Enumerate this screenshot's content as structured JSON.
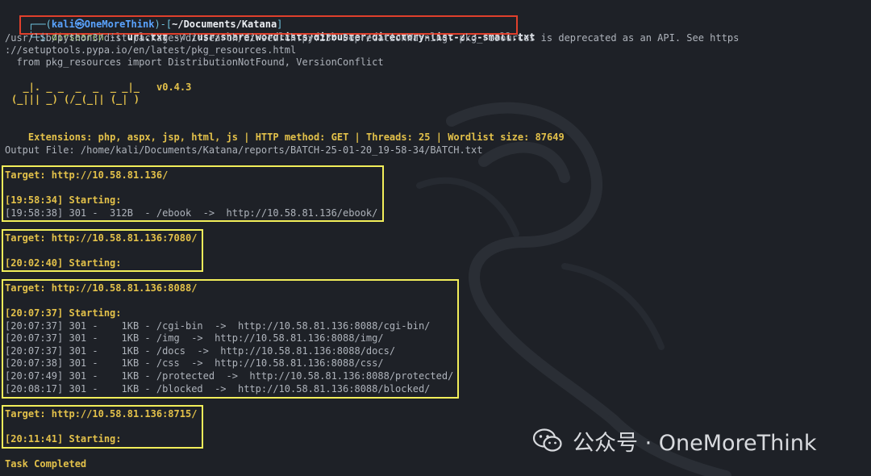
{
  "prompt": {
    "user": "kali",
    "at": "㉿",
    "host": "OneMoreThink",
    "path": "~/Documents/Katana",
    "top_left": "┌──(",
    "top_mid": ")-[",
    "top_right": "]",
    "bottom": "└─$"
  },
  "command": {
    "bin": "dirsearch",
    "flag1": "-l",
    "arg1": "url.txt",
    "flag2": "-w",
    "arg2": "/usr/share/wordlists/dirbuster/directory-list-2.3-small.txt"
  },
  "warning_lines": [
    "/usr/lib/python3/dist-packages/dirsearch/dirsearch.py:23: DeprecationWarning: pkg_resources is deprecated as an API. See https",
    "://setuptools.pypa.io/en/latest/pkg_resources.html",
    "  from pkg_resources import DistributionNotFound, VersionConflict"
  ],
  "banner": {
    "logo_line1": "  _|. _ _  _  _  _ _|_",
    "logo_line2": "(_||| _) (/_(_|| (_| )",
    "version": "v0.4.3"
  },
  "config": {
    "ext_label": "Extensions:",
    "ext_value": "php, aspx, jsp, html, js",
    "method_label": "HTTP method:",
    "method_value": "GET",
    "threads_label": "Threads:",
    "threads_value": "25",
    "wordlist_label": "Wordlist size:",
    "wordlist_value": "87649",
    "separator": " | "
  },
  "output_file": "Output File: /home/kali/Documents/Katana/reports/BATCH-25-01-20_19-58-34/BATCH.txt",
  "targets": [
    {
      "target": "Target: http://10.58.81.136/",
      "starting": "[19:58:34] Starting:",
      "results": [
        "[19:58:38] 301 -  312B  - /ebook  ->  http://10.58.81.136/ebook/"
      ]
    },
    {
      "target": "Target: http://10.58.81.136:7080/",
      "starting": "[20:02:40] Starting:",
      "results": []
    },
    {
      "target": "Target: http://10.58.81.136:8088/",
      "starting": "[20:07:37] Starting:",
      "results": [
        "[20:07:37] 301 -    1KB - /cgi-bin  ->  http://10.58.81.136:8088/cgi-bin/",
        "[20:07:37] 301 -    1KB - /img  ->  http://10.58.81.136:8088/img/",
        "[20:07:37] 301 -    1KB - /docs  ->  http://10.58.81.136:8088/docs/",
        "[20:07:38] 301 -    1KB - /css  ->  http://10.58.81.136:8088/css/",
        "[20:07:49] 301 -    1KB - /protected  ->  http://10.58.81.136:8088/protected/",
        "[20:08:17] 301 -    1KB - /blocked  ->  http://10.58.81.136:8088/blocked/"
      ]
    },
    {
      "target": "Target: http://10.58.81.136:8715/",
      "starting": "[20:11:41] Starting:",
      "results": []
    }
  ],
  "task_completed": "Task Completed",
  "watermark": {
    "icon": "wechat-icon",
    "text": "公众号 · OneMoreThink"
  },
  "colors": {
    "background": "#1e2127",
    "prompt_blue": "#5aa3ff",
    "accent_yellow": "#e3c14a",
    "highlight_red": "#e0402c",
    "highlight_yellow": "#f2ee5a"
  }
}
